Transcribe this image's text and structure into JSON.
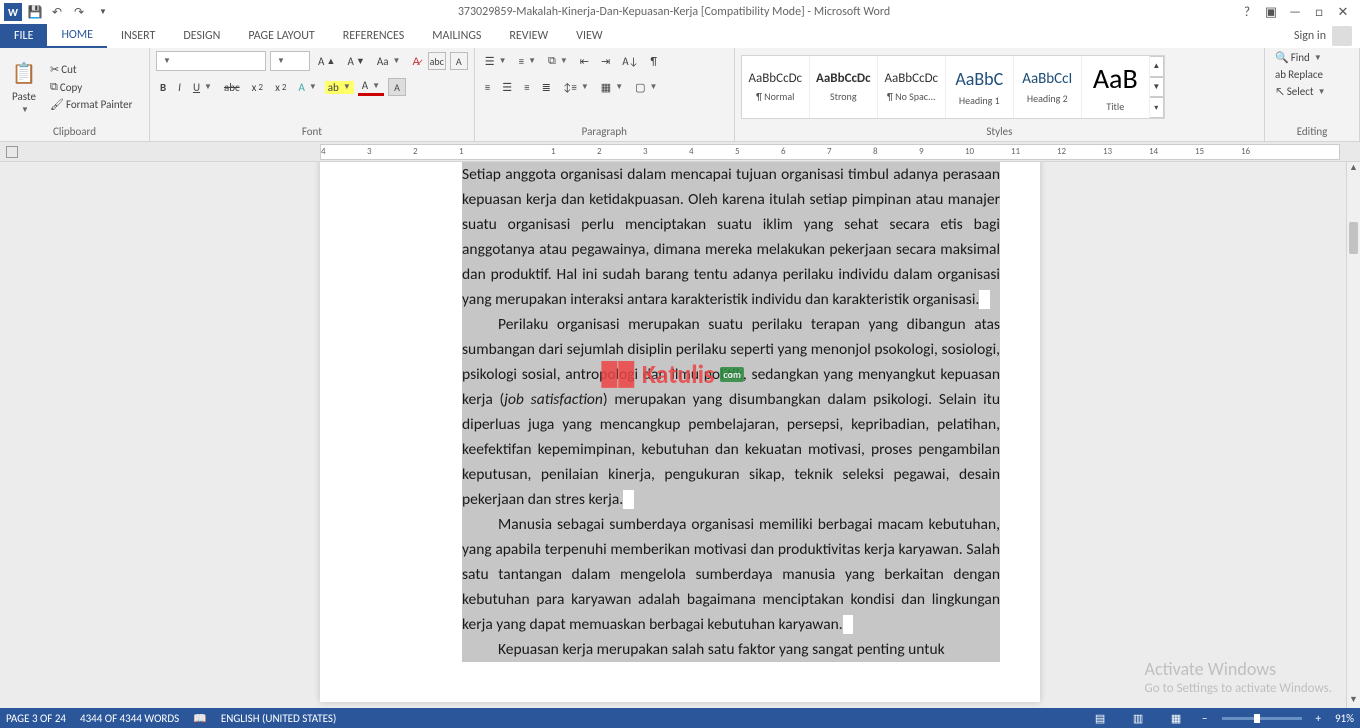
{
  "titlebar": {
    "title": "373029859-Makalah-Kinerja-Dan-Kepuasan-Kerja [Compatibility Mode] - Microsoft Word"
  },
  "tabs": {
    "file": "FILE",
    "items": [
      "HOME",
      "INSERT",
      "DESIGN",
      "PAGE LAYOUT",
      "REFERENCES",
      "MAILINGS",
      "REVIEW",
      "VIEW"
    ],
    "signin": "Sign in"
  },
  "ribbon": {
    "clipboard": {
      "paste": "Paste",
      "cut": "Cut",
      "copy": "Copy",
      "fmt": "Format Painter",
      "label": "Clipboard"
    },
    "font": {
      "family": "",
      "size": "",
      "label": "Font"
    },
    "paragraph": {
      "label": "Paragraph"
    },
    "styles": {
      "label": "Styles",
      "items": [
        {
          "preview": "AaBbCcDc",
          "name": "¶ Normal",
          "size": "13px",
          "color": "#333"
        },
        {
          "preview": "AaBbCcDc",
          "name": "Strong",
          "size": "13px",
          "color": "#333",
          "bold": true
        },
        {
          "preview": "AaBbCcDc",
          "name": "¶ No Spac...",
          "size": "13px",
          "color": "#333"
        },
        {
          "preview": "AaBbC",
          "name": "Heading 1",
          "size": "18px",
          "color": "#1f4e79"
        },
        {
          "preview": "AaBbCcI",
          "name": "Heading 2",
          "size": "15px",
          "color": "#1f4e79"
        },
        {
          "preview": "AaB",
          "name": "Title",
          "size": "28px",
          "color": "#000"
        }
      ]
    },
    "editing": {
      "find": "Find",
      "replace": "Replace",
      "select": "Select",
      "label": "Editing"
    }
  },
  "ruler": {
    "marks": [
      "4",
      "3",
      "2",
      "1",
      "",
      "1",
      "2",
      "3",
      "4",
      "5",
      "6",
      "7",
      "8",
      "9",
      "10",
      "11",
      "12",
      "13",
      "14",
      "15",
      "16"
    ]
  },
  "document": {
    "p1": "Setiap anggota organisasi dalam mencapai tujuan organisasi timbul adanya perasaan kepuasan kerja dan ketidakpuasan. Oleh karena itulah setiap pimpinan atau manajer suatu organisasi perlu menciptakan suatu iklim yang sehat secara etis bagi anggotanya atau pegawainya, dimana mereka melakukan pekerjaan secara maksimal dan produktif. Hal ini sudah barang tentu adanya perilaku individu dalam organisasi yang merupakan interaksi antara karakteristik individu dan karakteristik organisasi.",
    "p2a": "Perilaku organisasi merupakan suatu perilaku terapan yang dibangun atas sumbangan dari sejumlah disiplin perilaku seperti yang menonjol psokologi, sosiologi, psikologi sosial, antropologi dan ilmu politik, sedangkan yang menyangkut kepuasan kerja (",
    "p2i": "job satisfaction",
    "p2b": ") merupakan yang disumbangkan dalam psikologi. Selain itu diperluas juga yang mencangkup pembelajaran, persepsi, kepribadian, pelatihan, keefektifan kepemimpinan, kebutuhan dan kekuatan motivasi, proses pengambilan keputusan, penilaian kinerja, pengukuran sikap, teknik seleksi pegawai, desain pekerjaan dan stres kerja.",
    "p3": "Manusia sebagai sumberdaya organisasi memiliki berbagai macam kebutuhan, yang apabila terpenuhi memberikan motivasi dan produktivitas kerja karyawan. Salah satu tantangan dalam mengelola sumberdaya manusia yang berkaitan dengan kebutuhan para karyawan adalah bagaimana menciptakan kondisi dan lingkungan kerja yang dapat memuaskan berbagai kebutuhan karyawan.",
    "p4": "Kepuasan kerja merupakan salah satu faktor yang sangat penting untuk"
  },
  "watermark": {
    "text": "Katulis",
    "badge": "com"
  },
  "activate": {
    "title": "Activate Windows",
    "sub": "Go to Settings to activate Windows."
  },
  "status": {
    "page": "PAGE 3 OF 24",
    "words": "4344 OF 4344 WORDS",
    "lang": "ENGLISH (UNITED STATES)",
    "zoom": "91%"
  }
}
